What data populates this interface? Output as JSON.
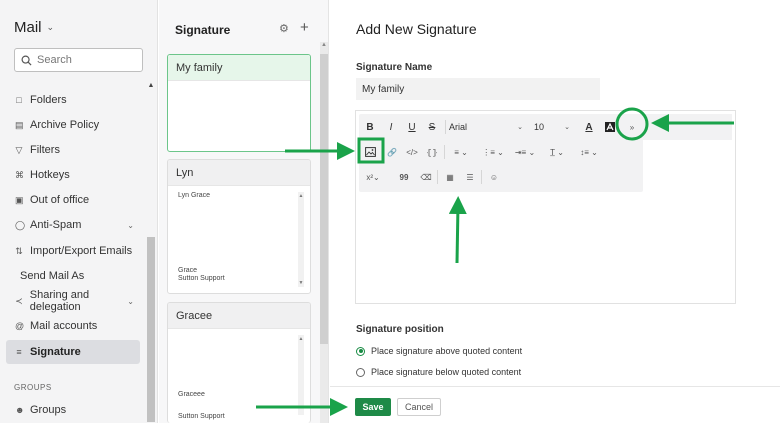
{
  "app": {
    "title": "Mail"
  },
  "search": {
    "placeholder": "Search"
  },
  "sidebar": {
    "items": [
      {
        "label": "Folders"
      },
      {
        "label": "Archive Policy"
      },
      {
        "label": "Filters"
      },
      {
        "label": "Hotkeys"
      },
      {
        "label": "Out of office"
      },
      {
        "label": "Anti-Spam"
      },
      {
        "label": "Import/Export Emails"
      },
      {
        "label": "Send Mail As"
      },
      {
        "label": "Sharing and delegation"
      },
      {
        "label": "Mail accounts"
      },
      {
        "label": "Signature"
      }
    ],
    "groups_heading": "GROUPS",
    "groups_item": "Groups"
  },
  "signatures": {
    "title": "Signature",
    "cards": [
      {
        "name": "My family",
        "lines": []
      },
      {
        "name": "Lyn",
        "lines": [
          "Lyn Grace",
          "Grace",
          "Sutton Support"
        ]
      },
      {
        "name": "Gracee",
        "lines": [
          "Graceee",
          "Sutton Support"
        ]
      }
    ]
  },
  "main": {
    "title": "Add New Signature",
    "name_label": "Signature Name",
    "name_value": "My family",
    "toolbar": {
      "bold": "B",
      "italic": "I",
      "underline": "U",
      "strike": "S",
      "font": "Arial",
      "size": "10",
      "text_color": "A",
      "superscript": "x²",
      "quote": "99"
    },
    "position_label": "Signature position",
    "option_above": "Place signature above quoted content",
    "option_below": "Place signature below quoted content",
    "save_label": "Save",
    "cancel_label": "Cancel"
  },
  "colors": {
    "accent": "#1e8a47",
    "annotation": "#1aa34a",
    "selected_card_border": "#6cc58a"
  }
}
